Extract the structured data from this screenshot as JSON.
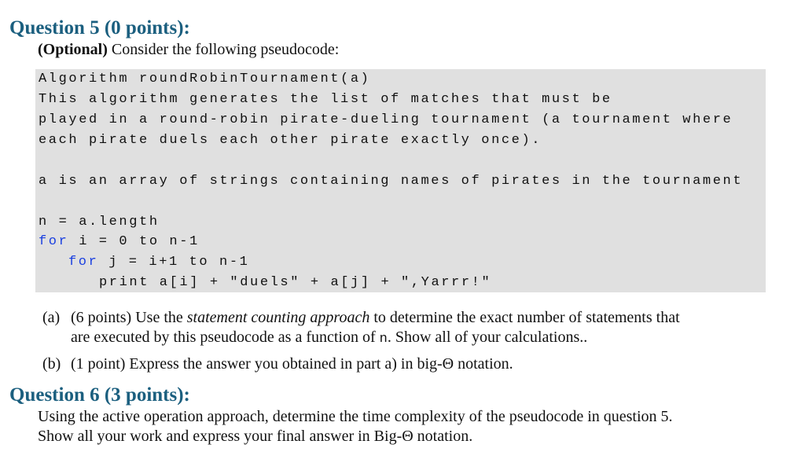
{
  "q5": {
    "title": "Question 5 (0 points):",
    "optional": "(Optional)",
    "intro": " Consider the following pseudocode:",
    "code": {
      "l1": "Algorithm roundRobinTournament(a)",
      "l2": "This algorithm generates the list of matches that must be",
      "l3": "played in a round-robin pirate-dueling tournament (a tournament where",
      "l4": "each pirate duels each other pirate exactly once).",
      "l5": "a is an array of strings containing names of pirates in the tournament",
      "l6": "n = a.length",
      "kw_for": "for",
      "l7": " i = 0 to n-1",
      "l8": " j = i+1 to n-1",
      "l9": "print a[i] + \"duels\" + a[j] + \",Yarrr!\""
    },
    "a": {
      "label": "(a)",
      "p1": "(6 points) Use the ",
      "em": "statement counting approach",
      "p2": " to determine the exact number of statements that",
      "line2a": "are executed by this pseudocode as a function of ",
      "n": "n",
      "line2b": ". Show all of your calculations.."
    },
    "b": {
      "label": "(b)",
      "text": "(1 point) Express the answer you obtained in part a) in big-Θ notation."
    }
  },
  "q6": {
    "title": "Question 6 (3 points):",
    "line1": "Using the active operation approach, determine the time complexity of the pseudocode in question 5.",
    "line2": "Show all your work and express your final answer in Big-Θ notation."
  }
}
